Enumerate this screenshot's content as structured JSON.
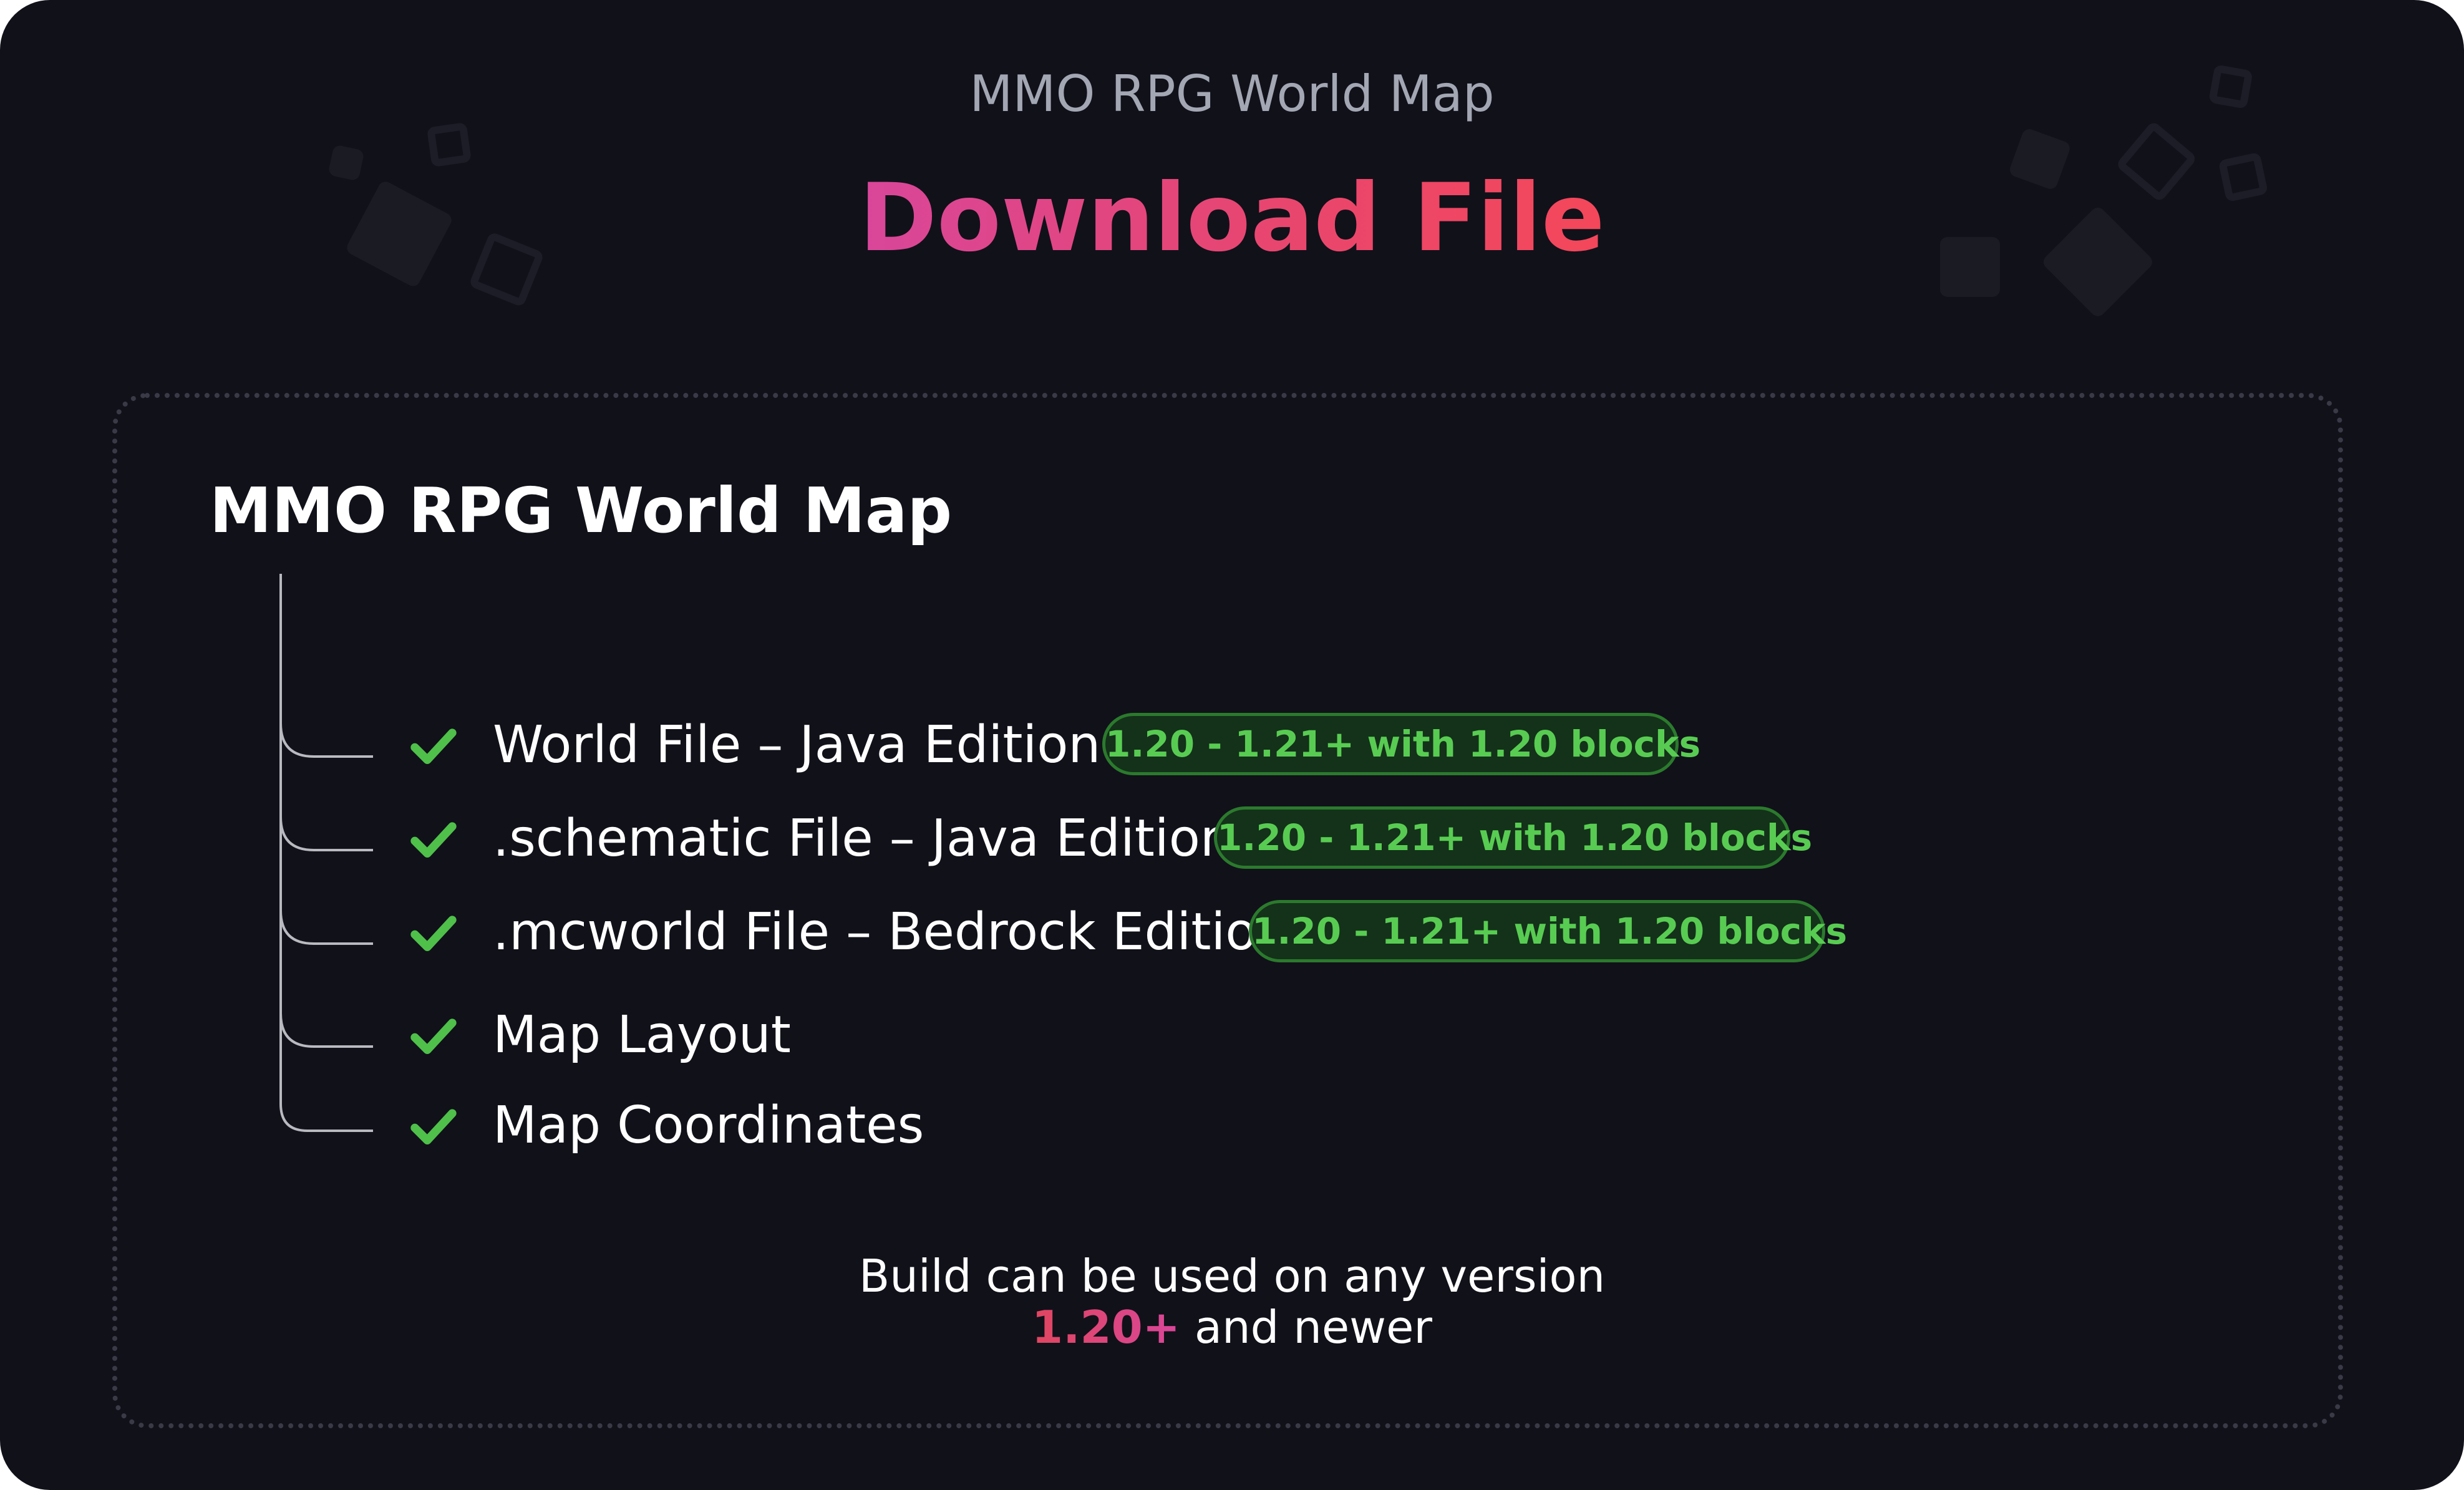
{
  "header": {
    "supertitle": "MMO RPG World Map",
    "title": "Download File"
  },
  "card": {
    "title": "MMO RPG World Map",
    "items": [
      {
        "label": "World File – Java Edition",
        "badge": "1.20 - 1.21+ with 1.20 blocks"
      },
      {
        "label": ".schematic File – Java Edition",
        "badge": "1.20 - 1.21+ with 1.20 blocks"
      },
      {
        "label": ".mcworld File – Bedrock Edition",
        "badge": "1.20 - 1.21+ with 1.20 blocks"
      },
      {
        "label": "Map Layout"
      },
      {
        "label": "Map Coordinates"
      }
    ],
    "check_icon": "check-icon",
    "footer": {
      "line1": "Build can be used on any version",
      "version": "1.20+",
      "suffix": " and newer"
    }
  },
  "colors": {
    "background": "#11111a",
    "title_gradient_start": "#d9469a",
    "title_gradient_end": "#f4475a",
    "check": "#4fc04a",
    "badge_text": "#58cc52",
    "badge_border": "#2b7a2d",
    "badge_bg": "#14311a",
    "supertitle": "#a3a7b3"
  }
}
